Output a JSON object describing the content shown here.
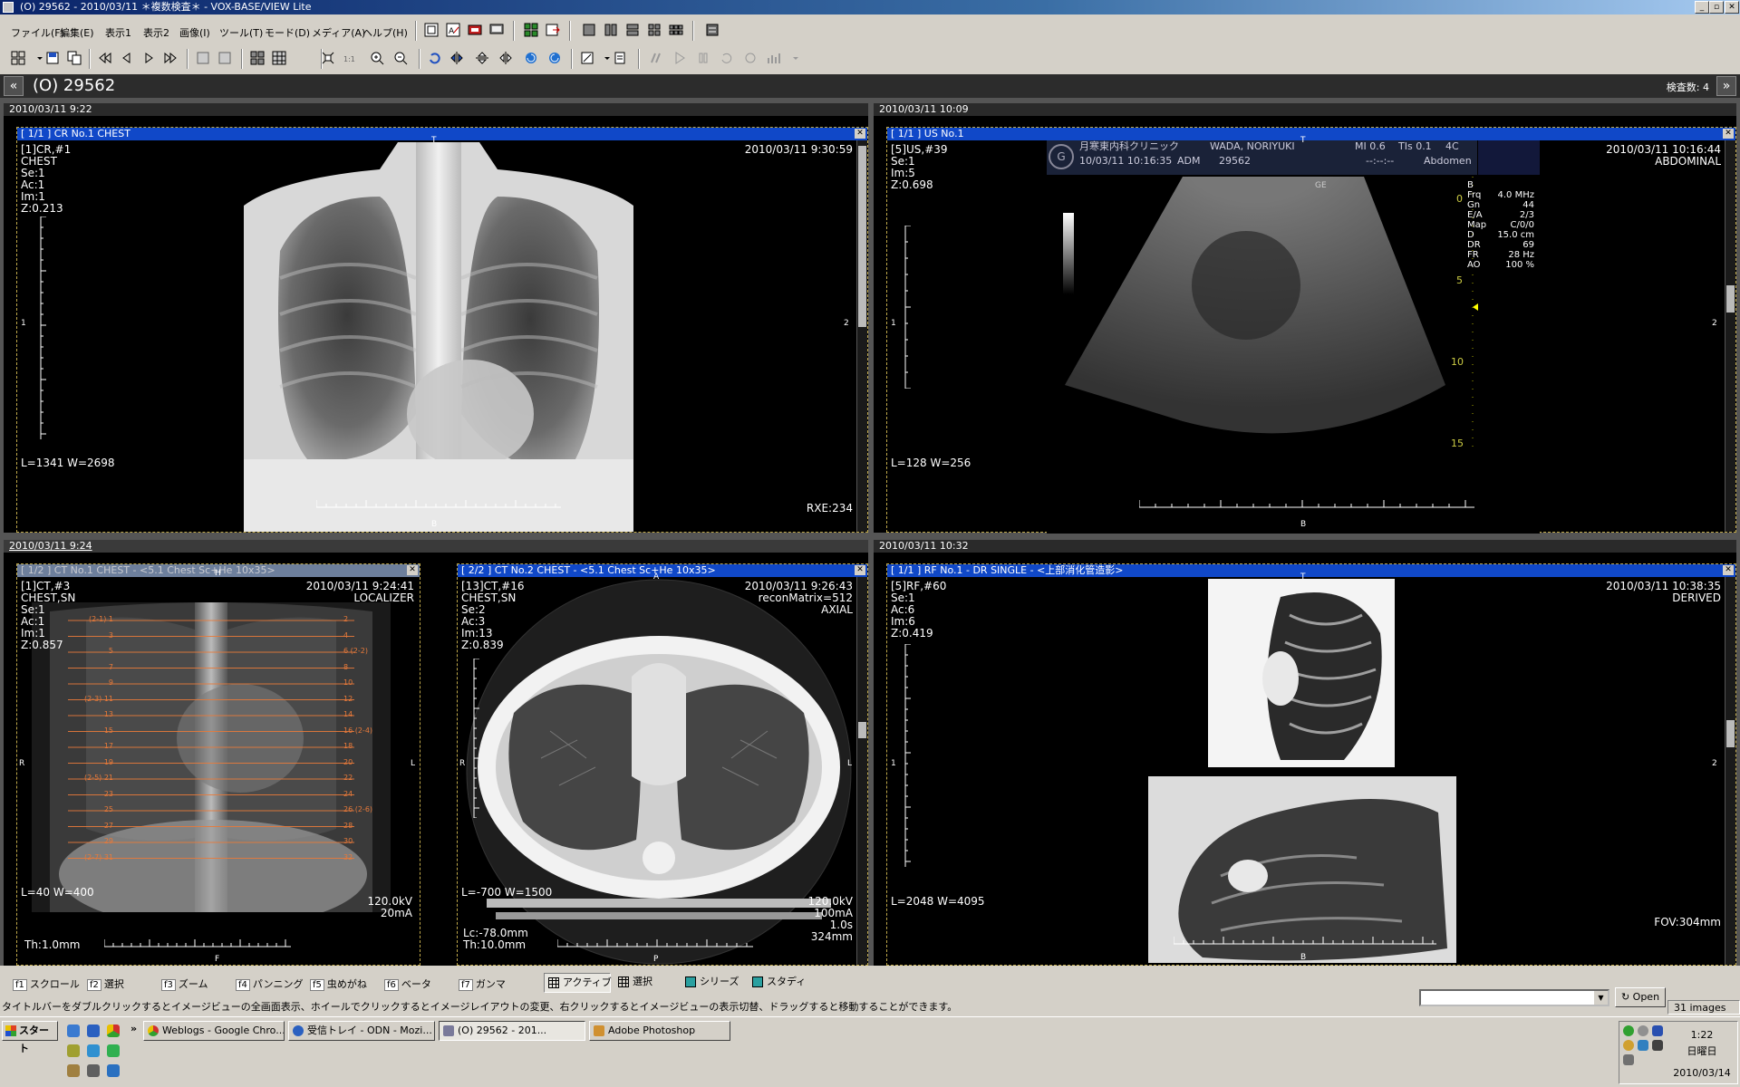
{
  "window": {
    "title": "(O)  29562  -  2010/03/11 ＊複数検査＊ - VOX-BASE/VIEW Lite"
  },
  "menu": [
    "ファイル(F)",
    "編集(E)",
    "表示1",
    "表示2",
    "画像(I)",
    "ツール(T)",
    "モード(D)",
    "メディア(A)",
    "ヘルプ(H)"
  ],
  "patient": {
    "id": "(O)  29562",
    "exam_count": "検査数: 4"
  },
  "quads": [
    {
      "date": "2010/03/11 9:22"
    },
    {
      "date": "2010/03/11 10:09"
    },
    {
      "date": "2010/03/11 9:24"
    },
    {
      "date": "2010/03/11 10:32"
    }
  ],
  "panes": {
    "cr": {
      "header": "[ 1/1 ] CR No.1 CHEST",
      "info": "[1]CR,#1\nCHEST\nSe:1\nAc:1\nIm:1\nZ:0.213",
      "datetime": "2010/03/11 9:30:59",
      "wl": "L=1341 W=2698",
      "br": "RXE:234",
      "mark_top": "T",
      "mark_bottom": "B",
      "mark_left": "1",
      "mark_right": "2"
    },
    "us": {
      "header": "[ 1/1 ] US No.1",
      "info": "[5]US,#39\nSe:1\nIm:5\nZ:0.698",
      "datetime": "2010/03/11 10:16:44",
      "type": "ABDOMINAL",
      "wl": "L=128 W=256",
      "clinic": "月寒東内科クリニック",
      "date2": "10/03/11 10:16:35",
      "adm": "ADM",
      "pid": "29562",
      "patient": "WADA, NORIYUKI",
      "mi": "MI 0.6",
      "tis": "TIs 0.1",
      "probe": "4C",
      "preset": "Abdomen",
      "ge": "GE",
      "params_label": "B\nFrq\nGn\nE/A\nMap\nD\nDR\nFR\nAO",
      "params_value": "\n4.0 MHz\n44\n2/3\nC/0/0\n15.0 cm\n69\n28 Hz\n100 %",
      "depth_marks": [
        "0",
        "5",
        "10",
        "15"
      ],
      "mark_top": "T",
      "mark_bottom": "B",
      "mark_left": "1",
      "mark_right": "2"
    },
    "ct1": {
      "header": "[ 1/2 ] CT No.1 CHEST  -  <5.1 Chest Sc+He 10x35>",
      "info": "[1]CT,#3\nCHEST,SN\nSe:1\nAc:1\nIm:1\nZ:0.857",
      "datetime": "2010/03/11 9:24:41",
      "type": "LOCALIZER",
      "wl": "L=40 W=400",
      "kv": "120.0kV\n20mA",
      "th": "Th:1.0mm",
      "mark_top": "H",
      "mark_bottom": "F",
      "mark_left": "R",
      "mark_right": "L",
      "lines_left": [
        "(2-1) 1",
        "3",
        "5",
        "7",
        "9",
        "(2-3) 11",
        "13",
        "15",
        "17",
        "19",
        "(2-5) 21",
        "23",
        "25",
        "27",
        "29",
        "(2-7) 31"
      ],
      "lines_right": [
        "2",
        "4",
        "6 (2-2)",
        "8",
        "10",
        "12",
        "14",
        "16 (2-4)",
        "18",
        "20",
        "22",
        "24",
        "26 (2-6)",
        "28",
        "30",
        "32"
      ]
    },
    "ct2": {
      "header": "[ 2/2 ] CT No.2 CHEST  -  <5.1 Chest Sc+He 10x35>",
      "info": "[13]CT,#16\nCHEST,SN\nSe:2\nAc:3\nIm:13\nZ:0.839",
      "datetime": "2010/03/11 9:26:43",
      "type": "reconMatrix=512\nAXIAL",
      "wl": "L=-700 W=1500",
      "lc": "Lc:-78.0mm\nTh:10.0mm",
      "kv": "120.0kV\n100mA\n1.0s\n324mm",
      "mark_top": "A",
      "mark_bottom": "P",
      "mark_left": "R",
      "mark_right": "L"
    },
    "rf": {
      "header": "[ 1/1 ] RF No.1  -  DR SINGLE  -  <上部消化管造影>",
      "info": "[5]RF,#60\nSe:1\nAc:6\nIm:6\nZ:0.419",
      "datetime": "2010/03/11 10:38:35",
      "type": "DERIVED",
      "wl": "L=2048 W=4095",
      "fov": "FOV:304mm",
      "mark_top": "T",
      "mark_bottom": "B",
      "mark_left": "1",
      "mark_right": "2"
    }
  },
  "fkeys": [
    {
      "key": "f1",
      "label": "スクロール"
    },
    {
      "key": "f2",
      "label": "選択"
    },
    {
      "key": "f3",
      "label": "ズーム"
    },
    {
      "key": "f4",
      "label": "パンニング"
    },
    {
      "key": "f5",
      "label": "虫めがね"
    },
    {
      "key": "f6",
      "label": "ベータ"
    },
    {
      "key": "f7",
      "label": "ガンマ"
    }
  ],
  "modes": [
    "アクティブ",
    "選択",
    "シリーズ",
    "スタディ"
  ],
  "help_text": "タイトルバーをダブルクリックするとイメージビューの全画面表示、ホイールでクリックするとイメージレイアウトの変更、右クリックするとイメージビューの表示切替、ドラッグすると移動することができます。",
  "open_label": "Open",
  "image_count": "31 images",
  "taskbar": {
    "start": "スタート",
    "tasks": [
      "Weblogs - Google Chro...",
      "受信トレイ - ODN - Mozi...",
      "(O)  29562  -  201...",
      "Adobe Photoshop"
    ],
    "time": "1:22",
    "weekday": "日曜日",
    "date": "2010/03/14"
  }
}
